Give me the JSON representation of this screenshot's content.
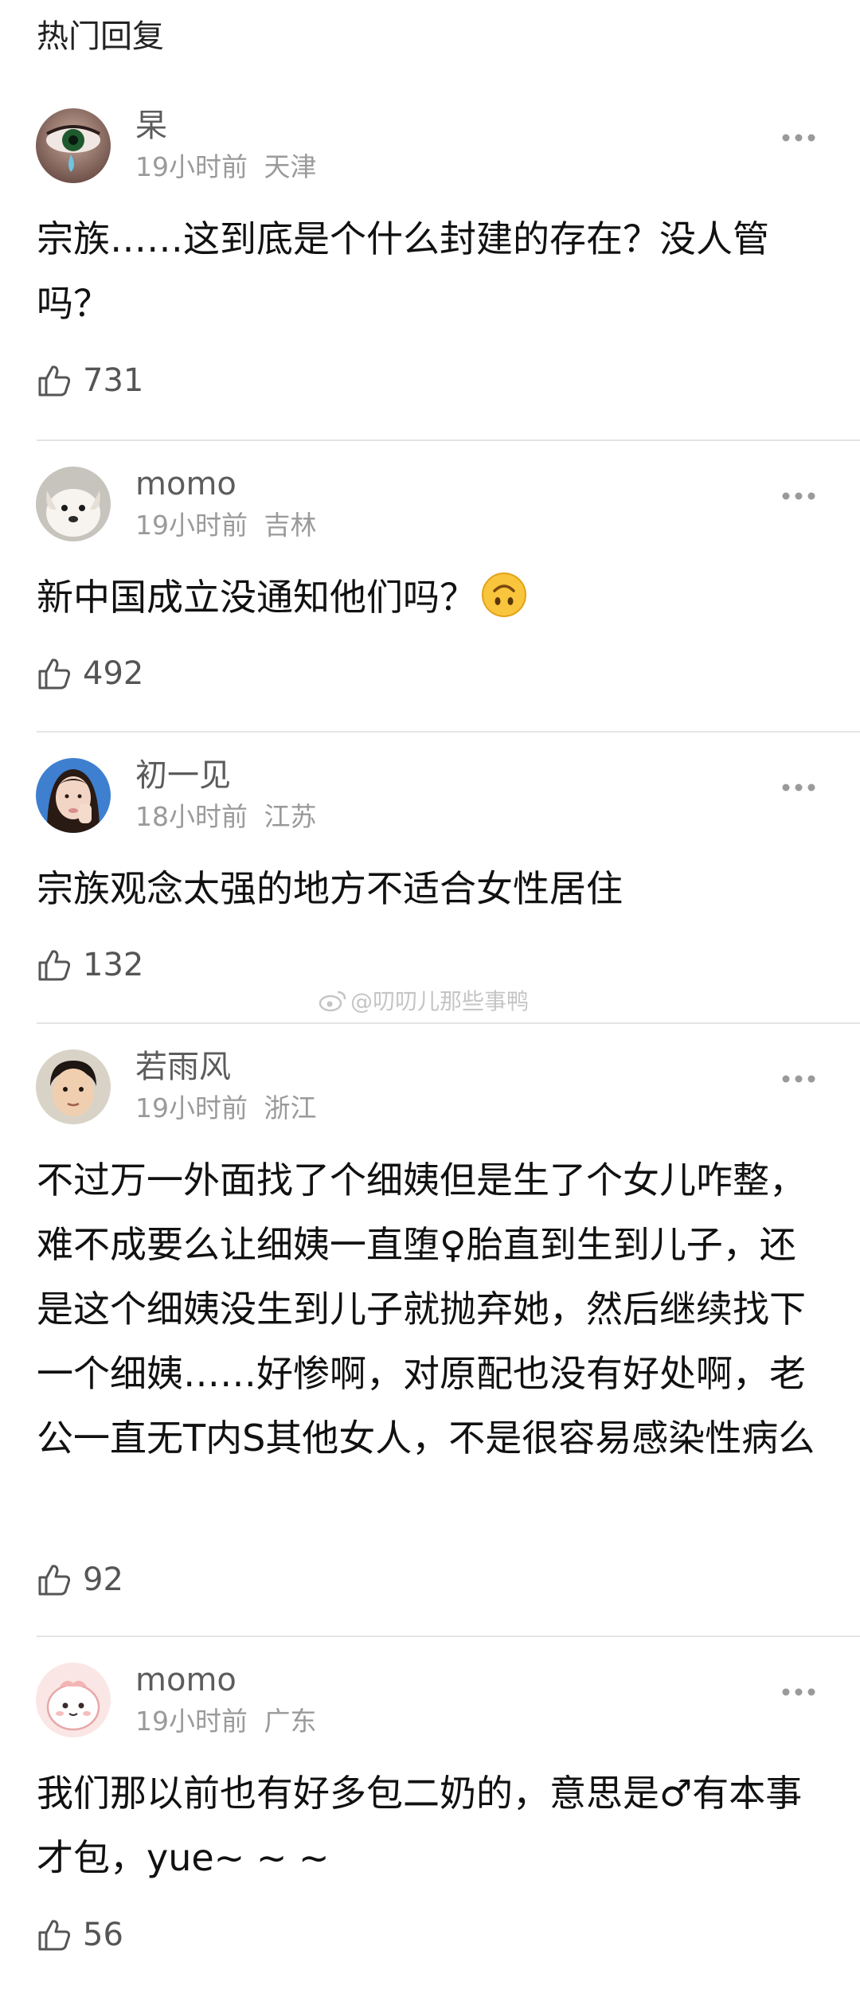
{
  "section_title": "热门回复",
  "watermark": "@叨叨儿那些事鸭",
  "comments": [
    {
      "username": "杲",
      "time": "19小时前",
      "location": "天津",
      "content": "宗族……这到底是个什么封建的存在？没人管吗？",
      "likes": "731",
      "avatar": "crying-eye-avatar"
    },
    {
      "username": "momo",
      "time": "19小时前",
      "location": "吉林",
      "content": "新中国成立没通知他们吗？",
      "emoji": "upside-down-face-icon",
      "likes": "492",
      "avatar": "dog-avatar"
    },
    {
      "username": "初一见",
      "time": "18小时前",
      "location": "江苏",
      "content": "宗族观念太强的地方不适合女性居住",
      "likes": "132",
      "avatar": "girl-portrait-avatar"
    },
    {
      "username": "若雨风",
      "time": "19小时前",
      "location": "浙江",
      "content": "不过万一外面找了个细姨但是生了个女儿咋整，难不成要么让细姨一直堕♀胎直到生到儿子，还是这个细姨没生到儿子就抛弃她，然后继续找下一个细姨……好惨啊，对原配也没有好处啊，老公一直无T内S其他女人，不是很容易感染性病么",
      "likes": "92",
      "avatar": "child-photo-avatar"
    },
    {
      "username": "momo",
      "time": "19小时前",
      "location": "广东",
      "content": "我们那以前也有好多包二奶的，意思是♂有本事才包，yue~ ~ ~",
      "likes": "56",
      "avatar": "pink-cartoon-avatar"
    }
  ],
  "colors": {
    "username": "#5c5c5c",
    "meta": "#9a9a9a",
    "content": "#111111",
    "divider": "#e4e4e4"
  }
}
